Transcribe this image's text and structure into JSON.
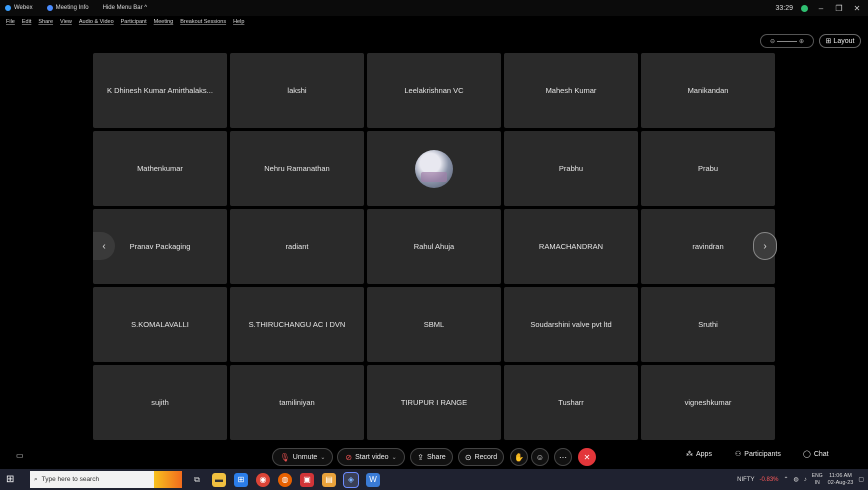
{
  "titlebar": {
    "app_name": "Webex",
    "meeting_info": "Meeting Info",
    "hide_menu": "Hide Menu Bar ^",
    "timer": "33:29",
    "minimize": "–",
    "restore": "❐",
    "close": "✕"
  },
  "menu": [
    "File",
    "Edit",
    "Share",
    "View",
    "Audio & Video",
    "Participant",
    "Meeting",
    "Breakout Sessions",
    "Help"
  ],
  "toolbar": {
    "layout_label": "Layout"
  },
  "participants": [
    "K Dhinesh Kumar Amirthalaks...",
    "lakshi",
    "Leelakrishnan VC",
    "Mahesh Kumar",
    "Manikandan",
    "Mathenkumar",
    "Nehru Ramanathan",
    "",
    "Prabhu",
    "Prabu",
    "Pranav Packaging",
    "radiant",
    "Rahul Ahuja",
    "RAMACHANDRAN",
    "ravindran",
    "S.KOMALAVALLI",
    "S.THIRUCHANGU AC I DVN",
    "SBML",
    "Soudarshini valve pvt ltd",
    "Sruthi",
    "sujith",
    "tamiliniyan",
    "TIRUPUR I RANGE",
    "Tusharr",
    "vigneshkumar"
  ],
  "controls": {
    "unmute": "Unmute",
    "start_video": "Start video",
    "share": "Share",
    "record": "Record",
    "apps": "Apps",
    "participants": "Participants",
    "chat": "Chat"
  },
  "taskbar": {
    "search_placeholder": "Type here to search",
    "nifty_label": "NIFTY",
    "nifty_change": "-0.83%",
    "lang_top": "ENG",
    "lang_bottom": "IN",
    "time": "11:06 AM",
    "date": "02-Aug-23"
  },
  "colors": {
    "tile_bg": "#2a2a2a",
    "end_call": "#e3363a",
    "accent": "#1f2230"
  }
}
